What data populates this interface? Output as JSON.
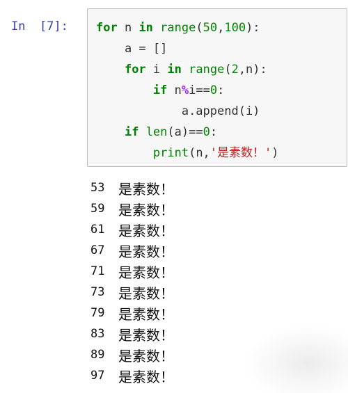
{
  "prompt": {
    "label": "In  [7]:"
  },
  "code": {
    "line1": {
      "kw1": "for",
      "t1": " n ",
      "kw2": "in",
      "t2": " ",
      "fn": "range",
      "t3": "(",
      "n1": "50",
      "t4": ",",
      "n2": "100",
      "t5": "):"
    },
    "line2": {
      "indent": "    ",
      "text": "a = []"
    },
    "line3": {
      "indent": "    ",
      "kw1": "for",
      "t1": " i ",
      "kw2": "in",
      "t2": " ",
      "fn": "range",
      "t3": "(",
      "n1": "2",
      "t4": ",n):"
    },
    "line4": {
      "indent": "        ",
      "kw1": "if",
      "t1": " n",
      "op": "%",
      "t2": "i==",
      "n1": "0",
      "t3": ":"
    },
    "line5": {
      "indent": "            ",
      "text": "a.append(i)"
    },
    "line6": {
      "indent": "    ",
      "kw1": "if",
      "t1": " ",
      "fn": "len",
      "t2": "(a)==",
      "n1": "0",
      "t3": ":"
    },
    "line7": {
      "indent": "        ",
      "fn": "print",
      "t1": "(n,",
      "str": "'是素数！'",
      "t2": ")"
    }
  },
  "output": [
    {
      "num": "53",
      "text": "是素数！"
    },
    {
      "num": "59",
      "text": "是素数！"
    },
    {
      "num": "61",
      "text": "是素数！"
    },
    {
      "num": "67",
      "text": "是素数！"
    },
    {
      "num": "71",
      "text": "是素数！"
    },
    {
      "num": "73",
      "text": "是素数！"
    },
    {
      "num": "79",
      "text": "是素数！"
    },
    {
      "num": "83",
      "text": "是素数！"
    },
    {
      "num": "89",
      "text": "是素数！"
    },
    {
      "num": "97",
      "text": "是素数！"
    }
  ],
  "colors": {
    "prompt": "#303f9f",
    "keyword": "#008000",
    "operator": "#aa22ff",
    "string": "#ba2121",
    "cell_background": "#f7f7f7",
    "cell_border": "#bdbdbd"
  }
}
